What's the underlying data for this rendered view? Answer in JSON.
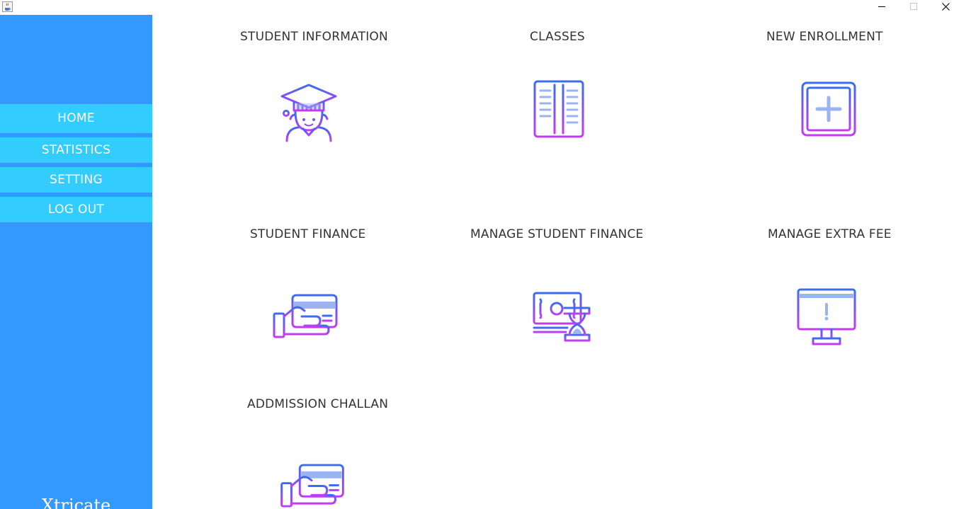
{
  "window": {
    "app_icon": "java-cup-icon",
    "controls": [
      "minimize-icon",
      "maximize-icon",
      "close-icon"
    ]
  },
  "sidebar": {
    "background": "#3399ff",
    "item_background": "#33ccff",
    "items": [
      {
        "label": "HOME"
      },
      {
        "label": "STATISTICS"
      },
      {
        "label": "SETTING"
      },
      {
        "label": "LOG OUT"
      }
    ],
    "brand": "Xtricate"
  },
  "tiles": [
    {
      "title": "STUDENT INFORMATION",
      "icon": "graduate-student-icon"
    },
    {
      "title": "CLASSES",
      "icon": "open-book-icon"
    },
    {
      "title": "NEW ENROLLMENT",
      "icon": "add-square-icon"
    },
    {
      "title": "STUDENT FINANCE",
      "icon": "hand-card-icon"
    },
    {
      "title": "MANAGE STUDENT FINANCE",
      "icon": "money-hourglass-icon"
    },
    {
      "title": "MANAGE EXTRA FEE",
      "icon": "monitor-alert-icon"
    },
    {
      "title": "ADDMISSION CHALLAN",
      "icon": "hand-card-icon"
    }
  ],
  "colors": {
    "icon_gradient_top": "#3b6cf2",
    "icon_gradient_bottom": "#c23cf0",
    "icon_fill": "#9ab4f0"
  }
}
